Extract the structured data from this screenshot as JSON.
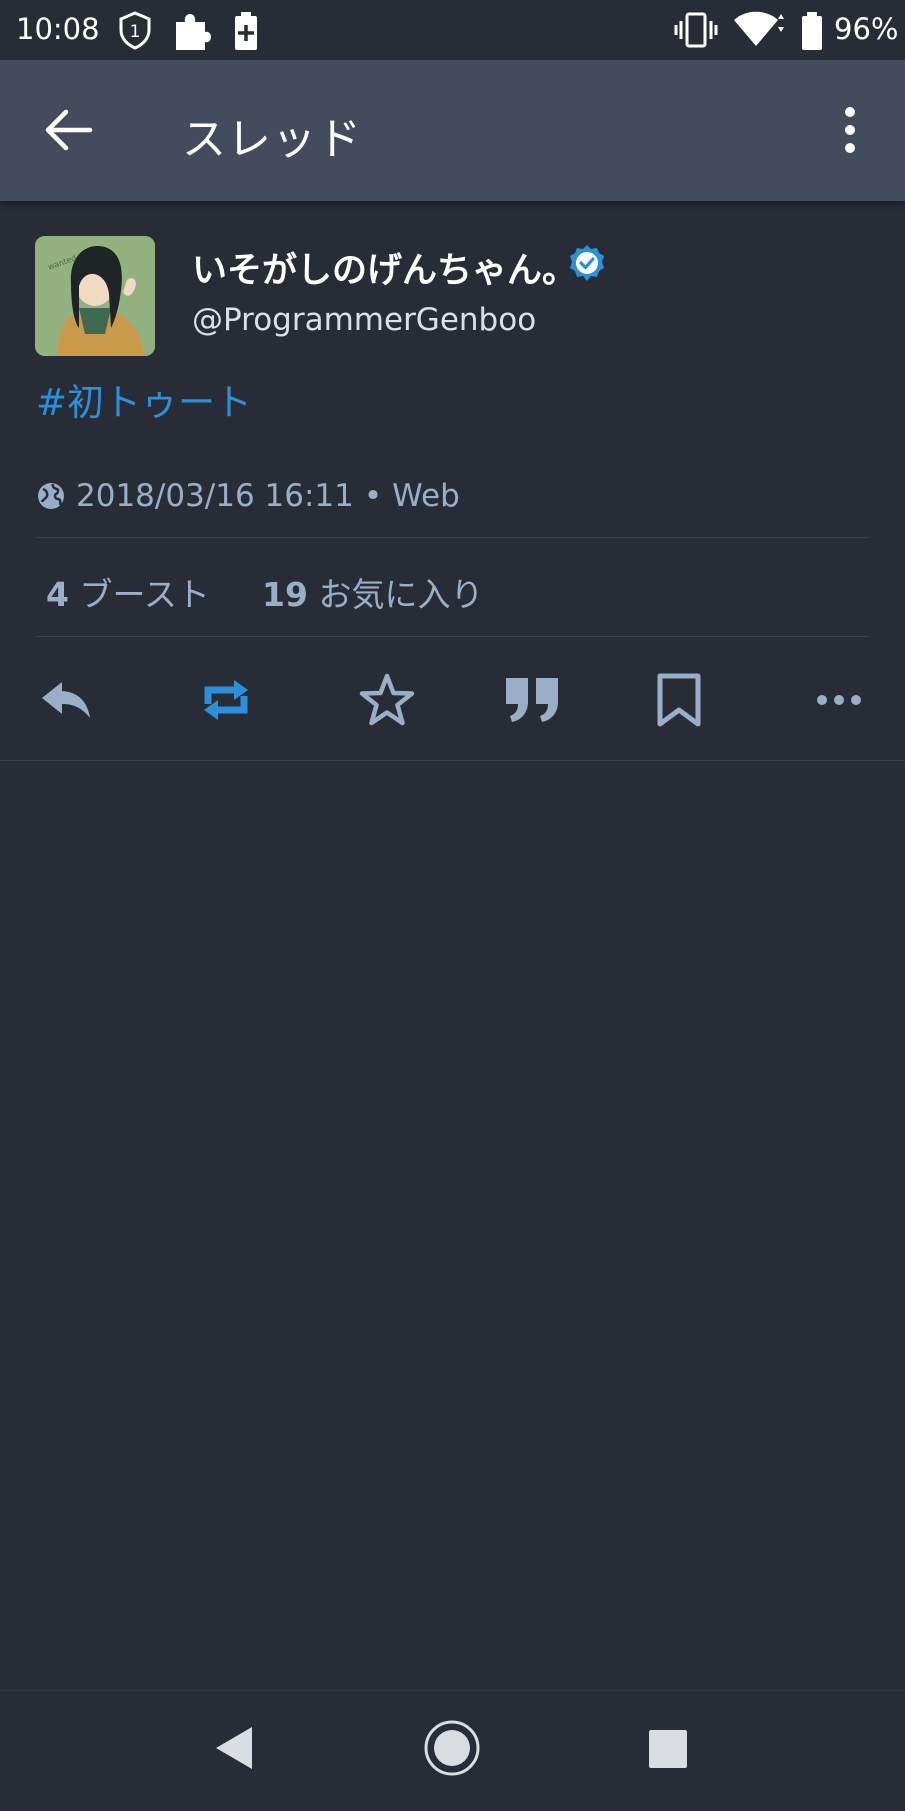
{
  "status_bar": {
    "time": "10:08",
    "battery_percent": "96%",
    "icons": [
      "shield-1-icon",
      "puzzle-icon",
      "battery-plus-icon",
      "vibrate-icon",
      "wifi-icon",
      "battery-icon"
    ]
  },
  "app_bar": {
    "title": "スレッド",
    "back_icon": "arrow-left-icon",
    "menu_icon": "more-vertical-icon"
  },
  "post": {
    "display_name": "いそがしのげんちゃん。",
    "verified": true,
    "handle": "@ProgrammerGenboo",
    "content": "#初トゥート",
    "date": "2018/03/16 16:11",
    "separator": "•",
    "application": "Web",
    "visibility_icon": "globe-icon",
    "boosts_count": "4",
    "boosts_label": "ブースト",
    "favourites_count": "19",
    "favourites_label": "お気に入り"
  },
  "actions": [
    {
      "icon": "reply-icon",
      "active": false
    },
    {
      "icon": "boost-icon",
      "active": true
    },
    {
      "icon": "star-icon",
      "active": false
    },
    {
      "icon": "quote-icon",
      "active": false
    },
    {
      "icon": "bookmark-icon",
      "active": false
    },
    {
      "icon": "more-horizontal-icon",
      "active": false
    }
  ],
  "nav_bar": {
    "buttons": [
      "back-triangle-icon",
      "home-circle-icon",
      "recents-square-icon"
    ]
  },
  "colors": {
    "background": "#282c37",
    "app_bar": "#444b5d",
    "accent": "#2b90d9",
    "muted": "#9baec8",
    "verified": "#2b90d9"
  }
}
